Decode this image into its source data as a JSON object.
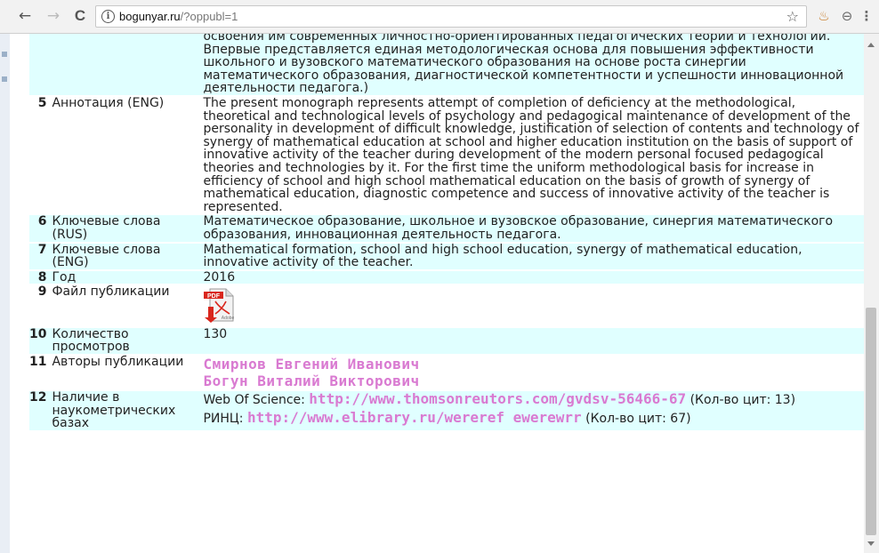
{
  "browser": {
    "back": "←",
    "forward": "→",
    "reload": "C",
    "url_host": "bogunyar.ru",
    "url_path": "/?oppubl=1",
    "star": "☆",
    "ext_icon": "♨",
    "account_icon": "⊖",
    "menu_icon": "⋮"
  },
  "rows": [
    {
      "num": "",
      "label": "",
      "value": "освоения им современных личностно-ориентированных педагогических теорий и технологий. Впервые представляется единая методологическая основа для повышения эффективности школьного и вузовского математического образования на основе роста синергии математического образования, диагностической компетентности и успешности инновационной деятельности педагога.)"
    },
    {
      "num": "5",
      "label": "Аннотация (ENG)",
      "value": "The present monograph represents attempt of completion of deficiency at the methodological, theoretical and technological levels of psychology and pedagogical maintenance of development of the personality in development of difficult knowledge, justification of selection of contents and technology of synergy of mathematical education at school and higher education institution on the basis of support of innovative activity of the teacher during development of the modern personal focused pedagogical theories and technologies by it. For the first time the uniform methodological basis for increase in efficiency of school and high school mathematical education on the basis of growth of synergy of mathematical education, diagnostic competence and success of innovative activity of the teacher is represented."
    },
    {
      "num": "6",
      "label": "Ключевые слова (RUS)",
      "value": "Математическое образование, школьное и вузовское образование, синергия математического образования, инновационная деятельность педагога."
    },
    {
      "num": "7",
      "label": "Ключевые слова (ENG)",
      "value": "Mathematical formation, school and high school education, synergy of mathematical education, innovative activity of the teacher."
    },
    {
      "num": "8",
      "label": "Год",
      "value": "2016"
    },
    {
      "num": "9",
      "label": "Файл публикации",
      "pdf_icon": "pdf-file-icon",
      "pdf_text": "PDF",
      "pdf_brand": "Adobe"
    },
    {
      "num": "10",
      "label": "Количество просмотров",
      "value": "130"
    },
    {
      "num": "11",
      "label": "Авторы публикации",
      "authors": [
        "Смирнов Евгений Иванович",
        "Богун Виталий Викторович"
      ]
    },
    {
      "num": "12",
      "label": "Наличие в наукометрических базах",
      "wos_prefix": "Web Of Science:",
      "wos_link": "http://www.thomsonreutors.com/gvdsv-56466-67",
      "wos_suffix": "(Кол-во цит: 13)",
      "rinc_prefix": "РИНЦ:",
      "rinc_link": "http://www.elibrary.ru/wereref ewerewrr",
      "rinc_suffix": "(Кол-во цит: 67)"
    }
  ],
  "colors": {
    "row_bg": "#e0ffff",
    "link": "#d97ad1",
    "pdf_red": "#d9261c"
  }
}
